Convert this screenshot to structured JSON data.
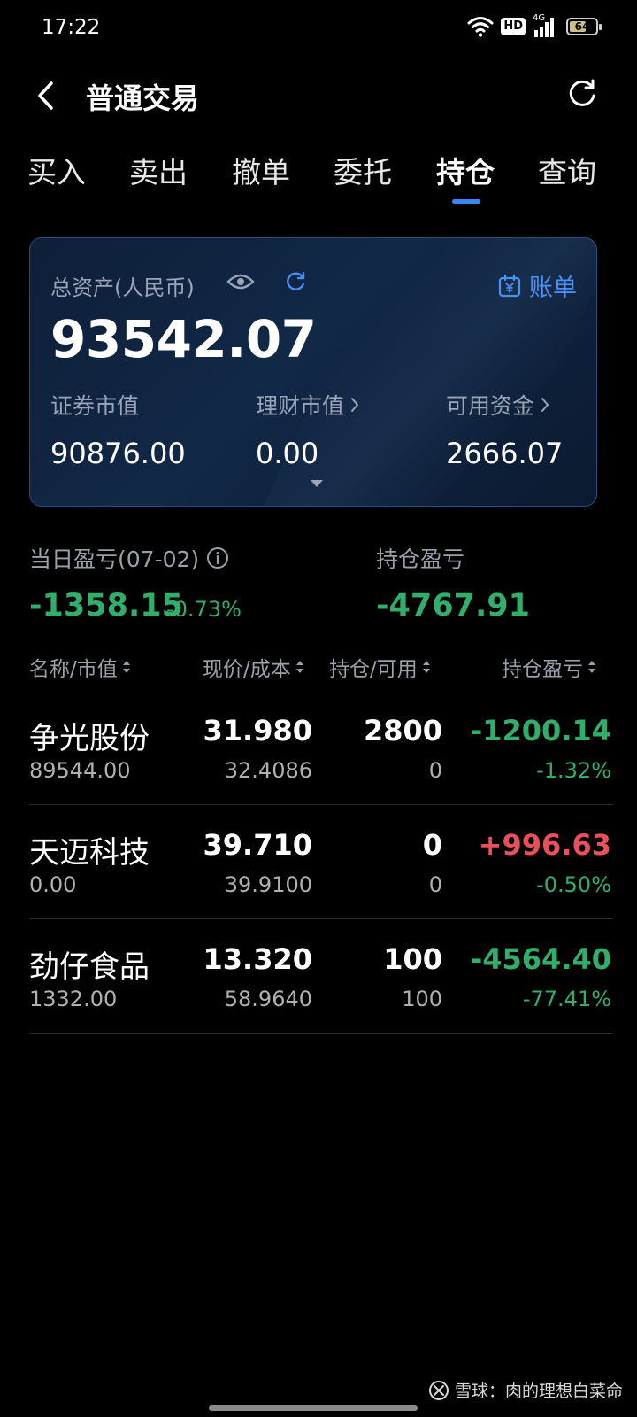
{
  "status_bar": {
    "time": "17:22",
    "hd": "HD",
    "network": "4G",
    "battery": "64",
    "battery_level": 0.64
  },
  "header": {
    "title": "普通交易",
    "back_icon": "chevron-left-icon",
    "refresh_icon": "refresh-icon"
  },
  "tabs": [
    {
      "label": "买入",
      "active": false
    },
    {
      "label": "卖出",
      "active": false
    },
    {
      "label": "撤单",
      "active": false
    },
    {
      "label": "委托",
      "active": false
    },
    {
      "label": "持仓",
      "active": true
    },
    {
      "label": "查询",
      "active": false
    }
  ],
  "assets": {
    "total_label": "总资产(人民币)",
    "total_value": "93542.07",
    "bill_label": "账单",
    "securities_label": "证券市值",
    "securities_value": "90876.00",
    "wealth_label": "理财市值",
    "wealth_value": "0.00",
    "available_label": "可用资金",
    "available_value": "2666.07"
  },
  "pl_summary": {
    "day_label": "当日盈亏(07-02)",
    "day_value": "-1358.15",
    "day_pct": "-0.73%",
    "holding_label": "持仓盈亏",
    "holding_value": "-4767.91"
  },
  "table": {
    "headers": [
      "名称/市值",
      "现价/成本",
      "持仓/可用",
      "持仓盈亏"
    ],
    "rows": [
      {
        "name": "争光股份",
        "market_value": "89544.00",
        "price": "31.980",
        "cost": "32.4086",
        "holding": "2800",
        "available": "0",
        "pl": "-1200.14",
        "pl_pct": "-1.32%",
        "trend": "neg"
      },
      {
        "name": "天迈科技",
        "market_value": "0.00",
        "price": "39.710",
        "cost": "39.9100",
        "holding": "0",
        "available": "0",
        "pl": "+996.63",
        "pl_pct": "-0.50%",
        "trend": "pos"
      },
      {
        "name": "劲仔食品",
        "market_value": "1332.00",
        "price": "13.320",
        "cost": "58.9640",
        "holding": "100",
        "available": "100",
        "pl": "-4564.40",
        "pl_pct": "-77.41%",
        "trend": "neg"
      }
    ]
  },
  "watermark": {
    "text": "雪球：肉的理想白菜命"
  },
  "colors": {
    "accent": "#3a86f0",
    "loss": "#2fae6c",
    "gain": "#e8505b",
    "card_border": "#2b4e7e"
  }
}
